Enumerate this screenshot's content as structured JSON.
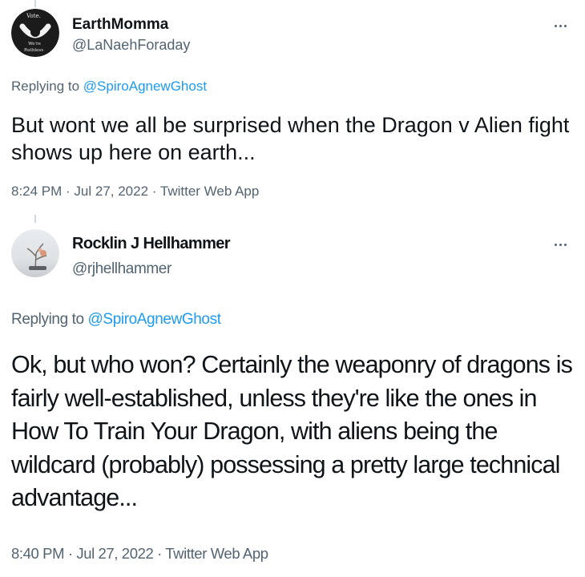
{
  "tweets": [
    {
      "display_name": "EarthMomma",
      "handle": "@LaNaehForaday",
      "replying_to_prefix": "Replying to ",
      "replying_to_handle": "@SpiroAgnewGhost",
      "text": "But wont we all be surprised when the Dragon v Alien fight shows up here on earth...",
      "time": "8:24 PM",
      "date": "Jul 27, 2022",
      "source": "Twitter Web App",
      "separator": " · ",
      "avatar_text": [
        "Vote.",
        "We're",
        "Ruthless"
      ],
      "more_icon": "more-horizontal-icon"
    },
    {
      "display_name": "Rocklin J Hellhammer",
      "handle": "@rjhellhammer",
      "replying_to_prefix": "Replying to ",
      "replying_to_handle": "@SpiroAgnewGhost",
      "text": "Ok, but who won? Certainly the weaponry of dragons is fairly well-established, unless they're like the ones in How To Train Your Dragon, with aliens being the wildcard (probably) possessing a pretty large technical advantage...",
      "time": "8:40 PM",
      "date": "Jul 27, 2022",
      "source": "Twitter Web App",
      "separator": " · ",
      "more_icon": "more-horizontal-icon"
    }
  ],
  "colors": {
    "text_primary": "#0f1419",
    "text_secondary": "#536471",
    "link": "#1d9bf0",
    "thread_line": "#cfd9de"
  }
}
